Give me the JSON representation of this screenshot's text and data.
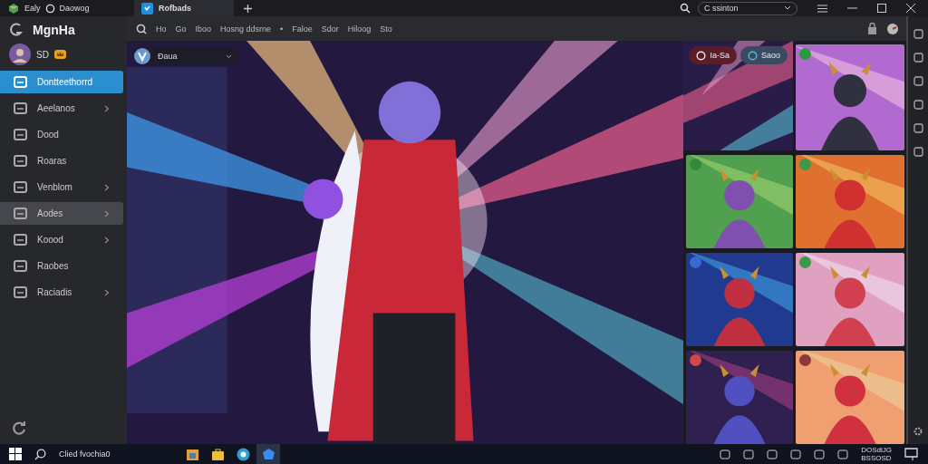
{
  "titlebar": {
    "app_name": "Ealy",
    "status": "Daowog",
    "tab": {
      "label": "Rofbads",
      "selected": true
    },
    "search": {
      "value": "C ssinton"
    }
  },
  "sidebar": {
    "title": "MgnHa",
    "user": "SD",
    "items": [
      {
        "label": "Dontteethorrd",
        "selected": true,
        "hovered": false,
        "expandable": false
      },
      {
        "label": "Aeelanos",
        "selected": false,
        "hovered": false,
        "expandable": true
      },
      {
        "label": "Dood",
        "selected": false,
        "hovered": false,
        "expandable": false
      },
      {
        "label": "Roaras",
        "selected": false,
        "hovered": false,
        "expandable": false
      },
      {
        "label": "Venblom",
        "selected": false,
        "hovered": false,
        "expandable": true
      },
      {
        "label": "Aodes",
        "selected": false,
        "hovered": true,
        "expandable": true
      },
      {
        "label": "Koood",
        "selected": false,
        "hovered": false,
        "expandable": true
      },
      {
        "label": "Raobes",
        "selected": false,
        "hovered": false,
        "expandable": false
      },
      {
        "label": "Raciadis",
        "selected": false,
        "hovered": false,
        "expandable": true
      }
    ]
  },
  "toolbar": {
    "links": [
      "Ho",
      "Go",
      "Iboo",
      "Hosng ddsrne",
      "•",
      "Faloe",
      "Sdor",
      "Hiloog",
      "Sto"
    ]
  },
  "viewer": {
    "selector": "Ðaua",
    "chips": [
      "Ia-Sa",
      "Saoo"
    ]
  },
  "gallery": {
    "columns": [
      {
        "items": [
          {
            "color": "#2f8a3a"
          },
          {
            "color": "#3a6ad0"
          },
          {
            "color": "#d04848"
          }
        ]
      },
      {
        "items": [
          {
            "color": "#2a9a3a"
          },
          {
            "color": "#3a9a4a"
          },
          {
            "color": "#3a9a4a"
          },
          {
            "color": "#8a3a3a"
          }
        ]
      }
    ]
  },
  "taskbar": {
    "search": "Clied fvochia0",
    "apps": [
      {
        "selected": false
      },
      {
        "selected": false
      },
      {
        "selected": false
      },
      {
        "selected": true
      }
    ],
    "clock": {
      "time": "DOSdlJG",
      "date": "BSSOSD"
    }
  }
}
